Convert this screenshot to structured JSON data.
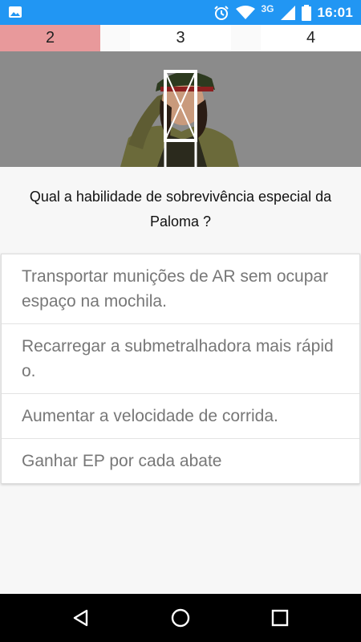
{
  "status_bar": {
    "left_icon": "image-notification-icon",
    "network": "3G",
    "time": "16:01",
    "icons": [
      "alarm-icon",
      "wifi-icon",
      "signal-icon",
      "battery-icon"
    ]
  },
  "tabs": [
    {
      "label": "2",
      "state": "active"
    },
    {
      "label": "3",
      "state": "default"
    },
    {
      "label": "4",
      "state": "default"
    }
  ],
  "hero": {
    "image": "character-portrait-image"
  },
  "question": "Qual a habilidade de sobrevivência especial da Paloma ?",
  "options": [
    "Transportar munições de AR sem ocupar espaço na mochila.",
    "Recarregar a submetralhadora mais rápido.",
    "Aumentar a velocidade de corrida.",
    "Ganhar EP por cada abate"
  ],
  "navbar": {
    "icons": [
      "back-icon",
      "home-icon",
      "recents-icon"
    ]
  },
  "colors": {
    "status_bar": "#2196f3",
    "active_tab": "#e8999b",
    "option_text": "#777777"
  }
}
